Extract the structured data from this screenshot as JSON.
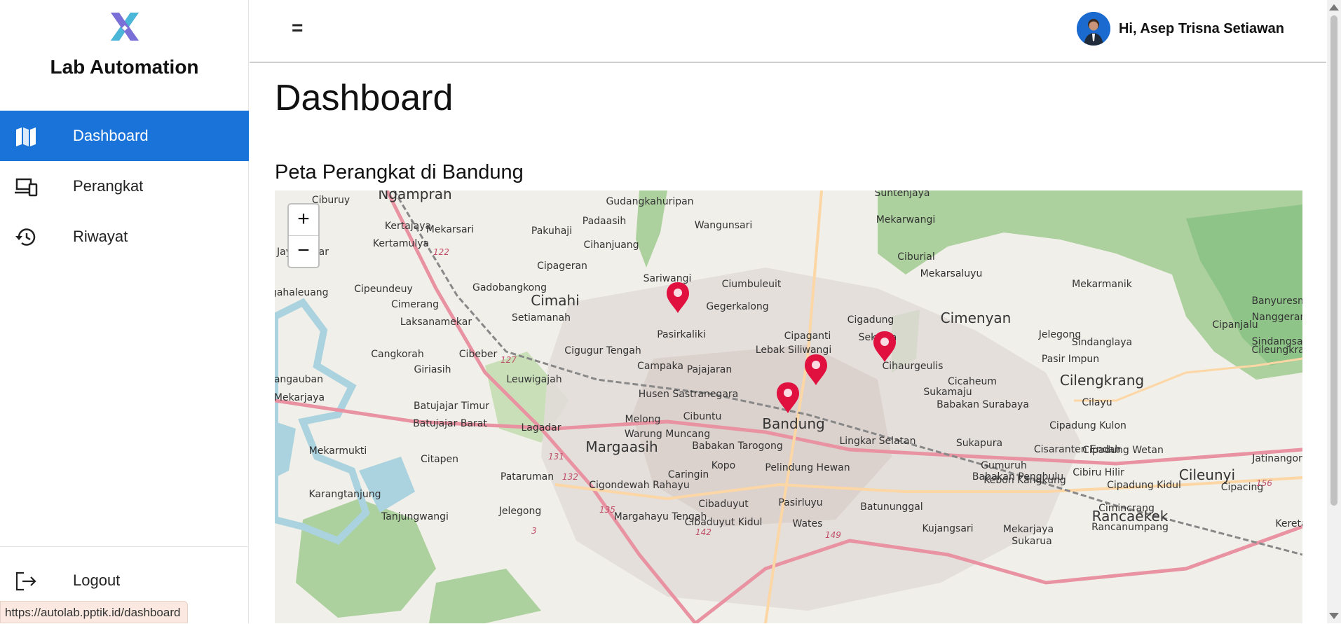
{
  "sidebar": {
    "app_title": "Lab Automation",
    "items": [
      {
        "label": "Dashboard",
        "icon": "map-icon",
        "active": true
      },
      {
        "label": "Perangkat",
        "icon": "devices-icon",
        "active": false
      },
      {
        "label": "Riwayat",
        "icon": "history-icon",
        "active": false
      }
    ],
    "logout_label": "Logout"
  },
  "header": {
    "menu_toggle": "=",
    "greeting": "Hi, Asep Trisna Setiawan"
  },
  "main": {
    "page_title": "Dashboard",
    "section_title": "Peta Perangkat di Bandung"
  },
  "map": {
    "zoom_in": "+",
    "zoom_out": "−",
    "place_labels": [
      "Ngamprah",
      "Gudangkahuripan",
      "Suntenjaya",
      "Ciburuy",
      "Kertajaya",
      "Mekarsari",
      "Padaasih",
      "Wangunsari",
      "Mekarwangi",
      "Kertamulya",
      "Pakuhaji",
      "Cihanjuang",
      "Ciburial",
      "Jayamekar",
      "Cipageran",
      "Gadobangkong",
      "Sariwangi",
      "Ciumbuleuit",
      "Mekarsaluyu",
      "Mekarmanik",
      "Cipeundeuy",
      "Cimahi",
      "Gegerkalong",
      "Cimenyan",
      "Banyuresmi",
      "Nanggerang",
      "Ngahaleuang",
      "Cimerang",
      "Setiamanah",
      "Cigadung",
      "Laksanamekar",
      "Pasirkaliki",
      "Cipaganti",
      "Sekeloa",
      "Cipanjalu",
      "Sindanglaya",
      "Sindangsari",
      "Cangkorah",
      "Cigugur Tengah",
      "Lebak Siliwangi",
      "Cileungkrang",
      "Cibeber",
      "Campaka",
      "Pajajaran",
      "Cihaurgeulis",
      "Pasir Impun",
      "Giriasih",
      "Leuwigajah",
      "Pangauban",
      "Cicaheum",
      "Cilengkrang",
      "Husen Sastranegara",
      "Sukamaju",
      "Mekarjaya",
      "Batujajar Timur",
      "Babakan Surabaya",
      "Cibuntu",
      "Bandung",
      "Batujajar Barat",
      "Lagadar",
      "Melong",
      "Cipadung Kulon",
      "Warung Muncang",
      "Babakan Tarogong",
      "Lingkar Selatan",
      "Sukapura",
      "Cisaranten Endah",
      "Margaasih",
      "Cipadung Wetan",
      "Jatinangor",
      "Mekarmukti",
      "Citapen",
      "Kopo",
      "Pelindung Hewan",
      "Gumuruh",
      "Babakan Penghulu",
      "Cibiru Hilir",
      "Cileunyi",
      "Pataruman",
      "Caringin",
      "Cigondewah Rahayu",
      "Kebon Kangkung",
      "Cipadung Kidul",
      "Cipacing",
      "Karangtanjung",
      "Cibaduyut",
      "Pasirluyu",
      "Batununggal",
      "Cimincrang",
      "Tanjungwangi",
      "Jelegong",
      "Margahayu Tengah",
      "Cibaduyut Kidul",
      "Wates",
      "Kujangsari",
      "Mekarjaya",
      "Rancanumpang",
      "Rancaekek",
      "Sukarua",
      "Kereta",
      "Jelegong",
      "Cilayu"
    ],
    "road_labels": [
      "122",
      "127",
      "131",
      "132",
      "135",
      "142",
      "149",
      "156",
      "3"
    ],
    "marker_count": 4
  },
  "status_url": "https://autolab.pptik.id/dashboard",
  "colors": {
    "accent": "#1a73d9",
    "marker": "#e0103f",
    "map_bg": "#f1efe9",
    "forest": "#8fc489"
  }
}
